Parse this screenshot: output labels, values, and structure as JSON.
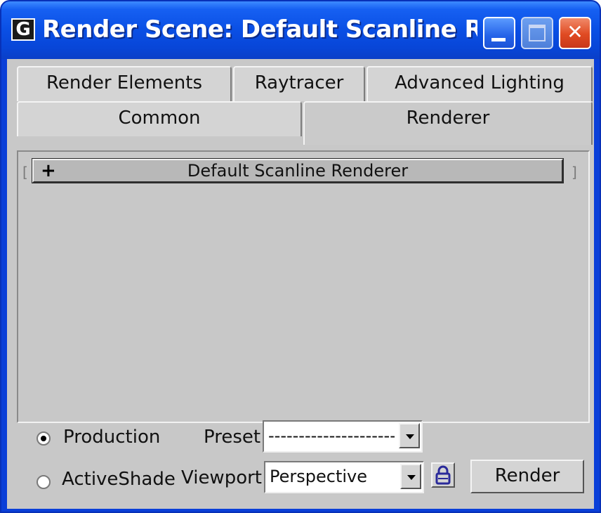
{
  "window": {
    "title": "Render Scene: Default Scanline Rende...",
    "app_icon_glyph": "G",
    "close_glyph": "✕"
  },
  "tabs": {
    "row1": [
      {
        "label": "Render Elements"
      },
      {
        "label": "Raytracer"
      },
      {
        "label": "Advanced Lighting"
      }
    ],
    "row2": [
      {
        "label": "Common"
      },
      {
        "label": "Renderer",
        "active": true
      }
    ]
  },
  "rollout": {
    "toggle": "+",
    "title": "Default Scanline Renderer"
  },
  "bottom": {
    "production_label": "Production",
    "production_selected": true,
    "activeshade_label": "ActiveShade",
    "activeshade_selected": false,
    "preset_label": "Preset:",
    "preset_value": "-------------------------",
    "viewport_label": "Viewport:",
    "viewport_value": "Perspective",
    "render_button": "Render"
  },
  "icons": {
    "app": "3dsmax-icon",
    "minimize": "minimize-icon",
    "maximize": "maximize-icon",
    "close": "close-icon",
    "dropdown": "chevron-down-icon",
    "lock": "lock-icon"
  },
  "colors": {
    "titlebar": "#0a4fe4",
    "client": "#c8c8c8",
    "close_button": "#e04a22",
    "lock_icon": "#2a2a9a"
  }
}
